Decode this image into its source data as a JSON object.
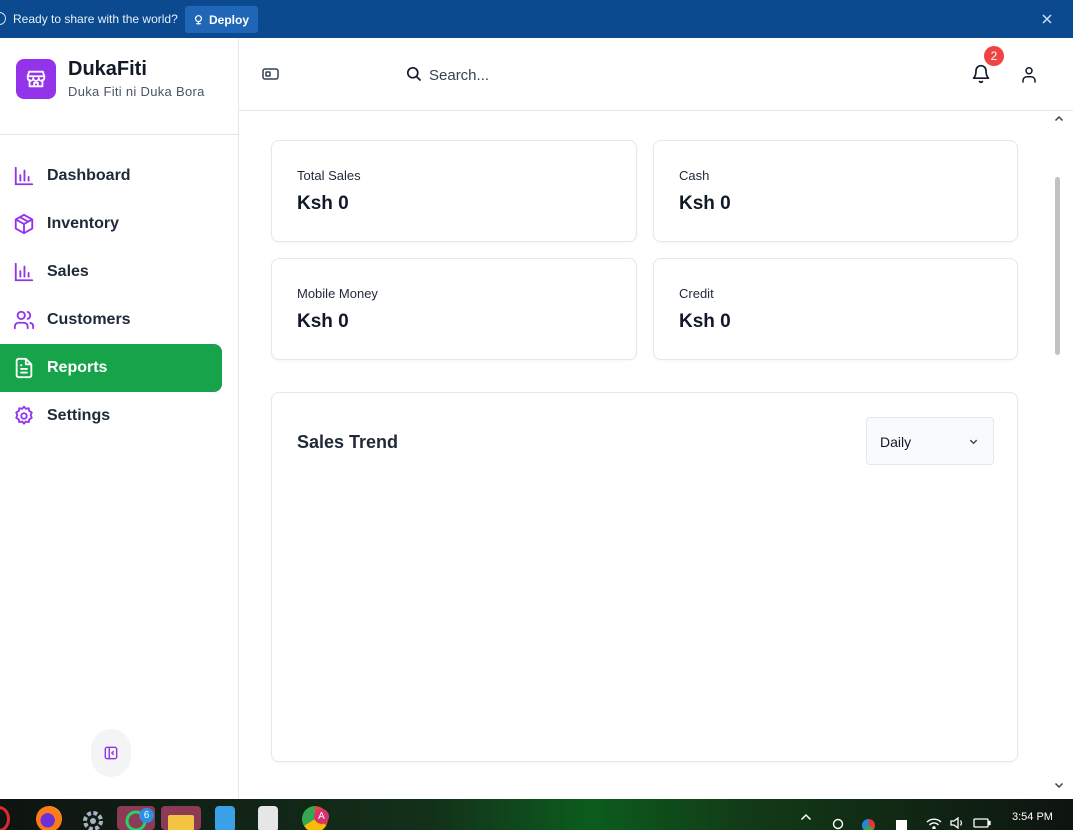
{
  "banner": {
    "message": "Ready to share with the world?",
    "deploy_label": "Deploy"
  },
  "brand": {
    "name": "DukaFiti",
    "tagline": "Duka Fiti ni Duka Bora",
    "color": "#9333ea"
  },
  "sidebar": {
    "items": [
      {
        "label": "Dashboard",
        "icon": "bar-chart-icon"
      },
      {
        "label": "Inventory",
        "icon": "package-icon"
      },
      {
        "label": "Sales",
        "icon": "bar-chart-icon"
      },
      {
        "label": "Customers",
        "icon": "users-icon"
      },
      {
        "label": "Reports",
        "icon": "file-text-icon",
        "active": true
      },
      {
        "label": "Settings",
        "icon": "gear-icon"
      }
    ],
    "active_color": "#16a34a",
    "icon_color": "#9333ea"
  },
  "header": {
    "search_placeholder": "Search...",
    "notification_count": "2"
  },
  "stats": [
    {
      "label": "Total Sales",
      "value": "Ksh 0"
    },
    {
      "label": "Cash",
      "value": "Ksh 0"
    },
    {
      "label": "Mobile Money",
      "value": "Ksh 0"
    },
    {
      "label": "Credit",
      "value": "Ksh 0"
    }
  ],
  "sales_trend": {
    "title": "Sales Trend",
    "period": "Daily"
  },
  "taskbar": {
    "whatsapp_badge": "6",
    "chrome_badge": "A",
    "time": "3:54 PM"
  }
}
